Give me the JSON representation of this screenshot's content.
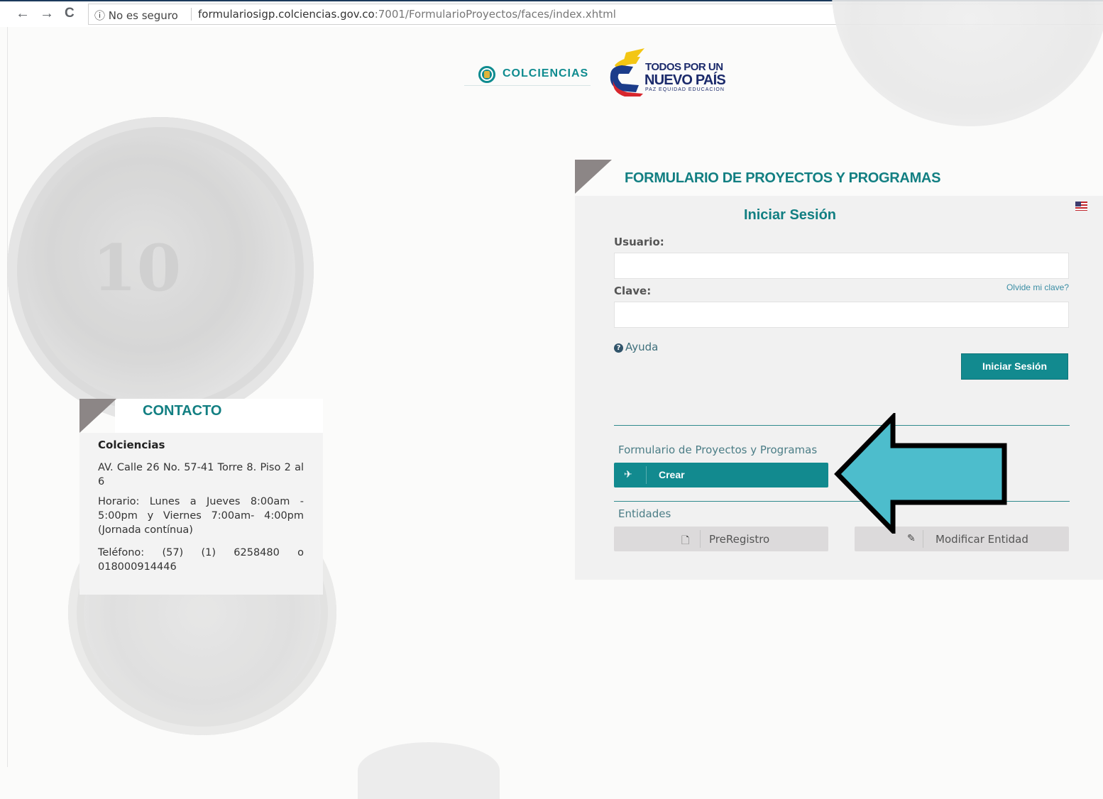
{
  "browser": {
    "back_glyph": "←",
    "forward_glyph": "→",
    "reload_glyph": "C",
    "security_text": "ⓘ No es seguro",
    "url_host": "formulariosigp.colciencias.gov.co",
    "url_rest": ":7001/FormularioProyectos/faces/index.xhtml"
  },
  "header": {
    "colciencias_label": "COLCIENCIAS",
    "gov_line1": "TODOS POR UN",
    "gov_line2": "NUEVO PAÍS",
    "gov_line3": "PAZ  EQUIDAD  EDUCACION"
  },
  "login": {
    "panel_title": "FORMULARIO DE PROYECTOS Y PROGRAMAS",
    "title": "Iniciar Sesión",
    "user_label": "Usuario:",
    "password_label": "Clave:",
    "user_value": "",
    "password_value": "",
    "forgot_label": "Olvide mi clave?",
    "help_label": "Ayuda",
    "submit_label": "Iniciar Sesión",
    "language_icon": "us-flag-icon"
  },
  "sections": {
    "projects_label": "Formulario de Proyectos y Programas",
    "create_label": "Crear",
    "entities_label": "Entidades",
    "preregister_label": "PreRegistro",
    "modify_label": "Modificar Entidad"
  },
  "contact": {
    "title": "CONTACTO",
    "name": "Colciencias",
    "address": "AV. Calle 26 No. 57-41 Torre 8. Piso 2 al 6",
    "hours": "Horario: Lunes a Jueves 8:00am - 5:00pm y Viernes 7:00am- 4:00pm (Jornada contínua)",
    "phone": "Teléfono: (57) (1) 6258480 o 018000914446"
  },
  "colors": {
    "accent": "#128a8f",
    "title_teal": "#127f82",
    "arrow_fill": "#4dbdcc"
  }
}
